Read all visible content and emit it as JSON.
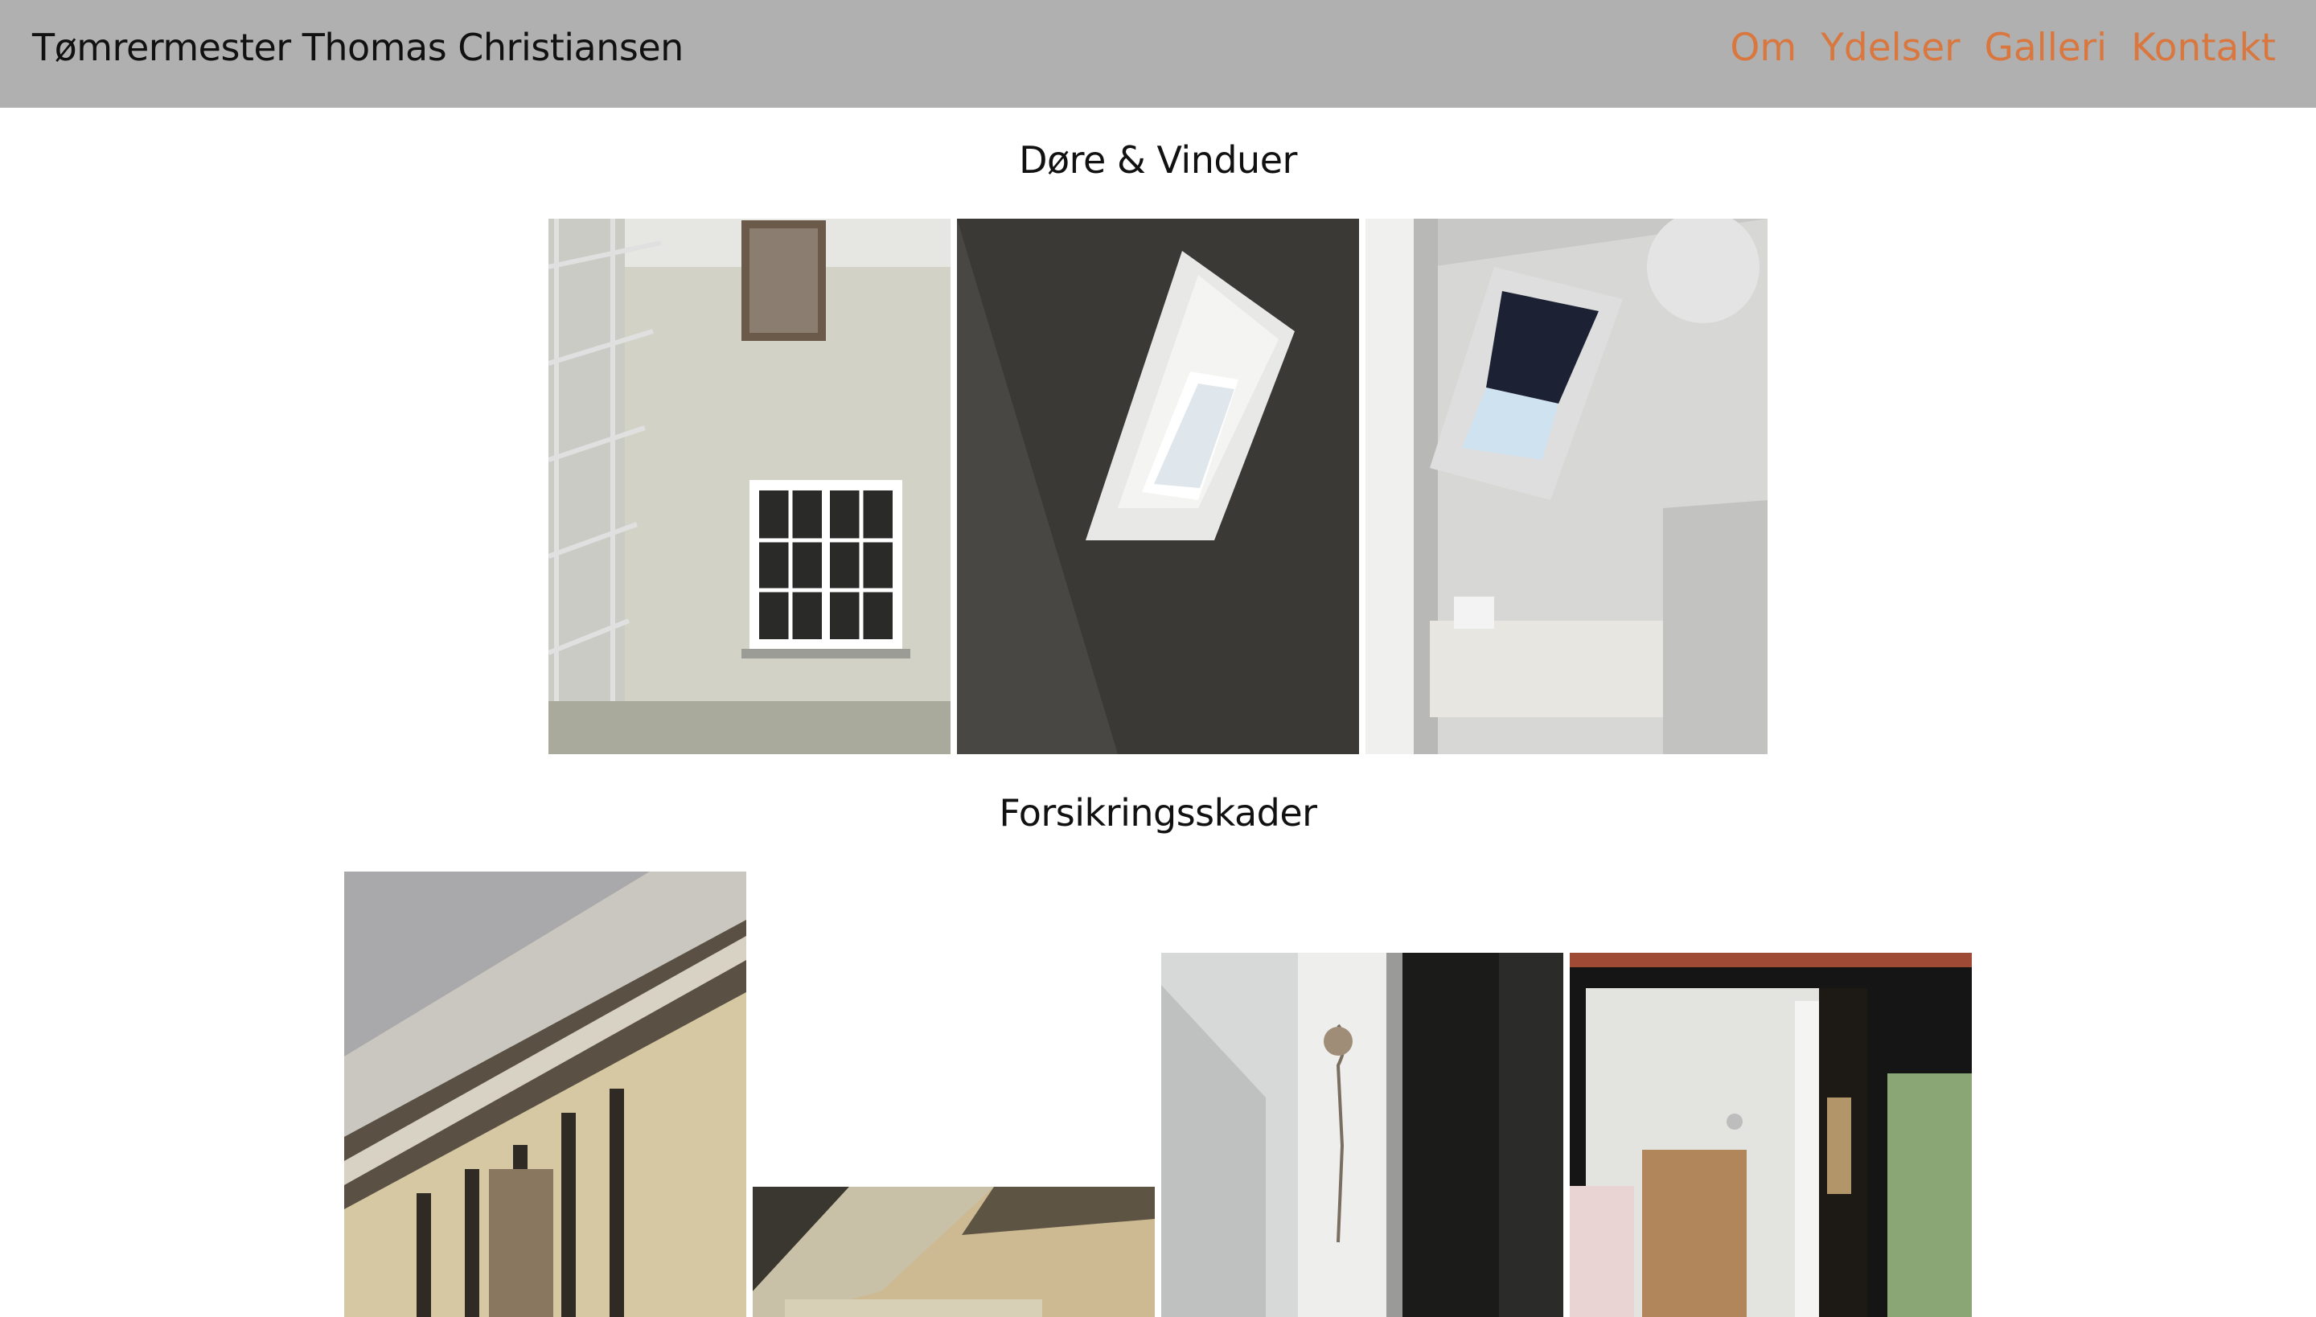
{
  "header": {
    "site_title": "Tømrermester Thomas Christiansen",
    "nav": [
      {
        "label": "Om"
      },
      {
        "label": "Ydelser"
      },
      {
        "label": "Galleri"
      },
      {
        "label": "Kontakt"
      }
    ]
  },
  "sections": [
    {
      "title": "Døre & Vinduer"
    },
    {
      "title": "Forsikringsskader"
    }
  ],
  "colors": {
    "header_bg": "#b0b0b0",
    "nav_link": "#d9773e",
    "text": "#111111"
  }
}
